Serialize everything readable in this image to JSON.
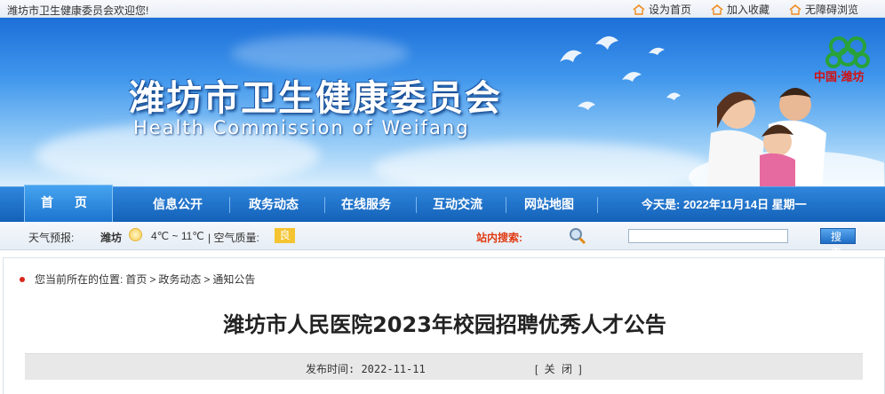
{
  "topbar": {
    "welcome": "潍坊市卫生健康委员会欢迎您!",
    "links": [
      {
        "label": "设为首页",
        "icon": "home-icon"
      },
      {
        "label": "加入收藏",
        "icon": "home-icon"
      },
      {
        "label": "无障碍浏览",
        "icon": "home-icon"
      }
    ]
  },
  "banner": {
    "title_cn": "潍坊市卫生健康委员会",
    "title_en": "Health Commission of Weifang",
    "logo_text": "中国·潍坊"
  },
  "nav": {
    "items": [
      "首 页",
      "信息公开",
      "政务动态",
      "在线服务",
      "互动交流",
      "网站地图"
    ],
    "date": "今天是: 2022年11月14日 星期一"
  },
  "weather": {
    "label": "天气预报:",
    "city": "潍坊",
    "temp": "4℃ ~ 11℃",
    "aq_label": "| 空气质量:",
    "aq_value": "良"
  },
  "search": {
    "label": "站内搜索:",
    "button": "搜 索",
    "placeholder": ""
  },
  "breadcrumb": {
    "prefix": "您当前所在的位置:",
    "items": [
      "首页",
      "政务动态",
      "通知公告"
    ]
  },
  "article": {
    "title": "潍坊市人民医院2023年校园招聘优秀人才公告",
    "publish": "发布时间: 2022-11-11",
    "close": "[ 关 闭 ]"
  },
  "colors": {
    "nav_blue": "#1361b8",
    "search_label_red": "#e03a12",
    "aq_yellow": "#f4c431",
    "logo_red": "#d40f0f"
  }
}
